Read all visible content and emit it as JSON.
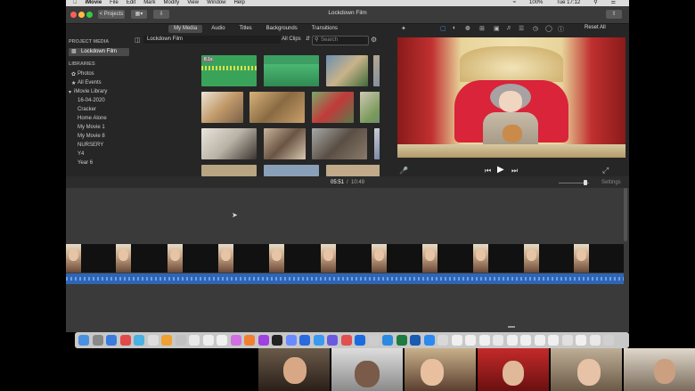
{
  "menubar": {
    "app_name": "iMovie",
    "items": [
      "File",
      "Edit",
      "Mark",
      "Modify",
      "View",
      "Window",
      "Help"
    ],
    "battery": "100%",
    "clock": "Tue 17:12"
  },
  "toolbar": {
    "projects_label": "< Projects",
    "window_title": "Lockdown Film"
  },
  "sidebar": {
    "project_media_heading": "PROJECT MEDIA",
    "project_item": "Lockdown Film",
    "libraries_heading": "LIBRARIES",
    "photos": "Photos",
    "all_events": "All Events",
    "library_name": "iMovie Library",
    "events": [
      "16-04-2020",
      "Cracker",
      "Home Alone",
      "My Movie 1",
      "My Movie 8",
      "NURSERY",
      "Y4",
      "Year 6"
    ]
  },
  "media": {
    "tabs": [
      "My Media",
      "Audio",
      "Titles",
      "Backgrounds",
      "Transitions"
    ],
    "active_tab": "My Media",
    "current_event": "Lockdown Film",
    "filter": "All Clips",
    "search_placeholder": "Search",
    "first_clip_duration": "8.1s"
  },
  "viewer": {
    "reset_all": "Reset All"
  },
  "timeline": {
    "current_time": "05:51",
    "separator": "/",
    "total_time": "10:49",
    "settings_label": "Settings"
  },
  "colors": {
    "accent_blue": "#2f65b5",
    "window_bg": "#2c2c2c",
    "timeline_bg": "#3a3a3a"
  }
}
